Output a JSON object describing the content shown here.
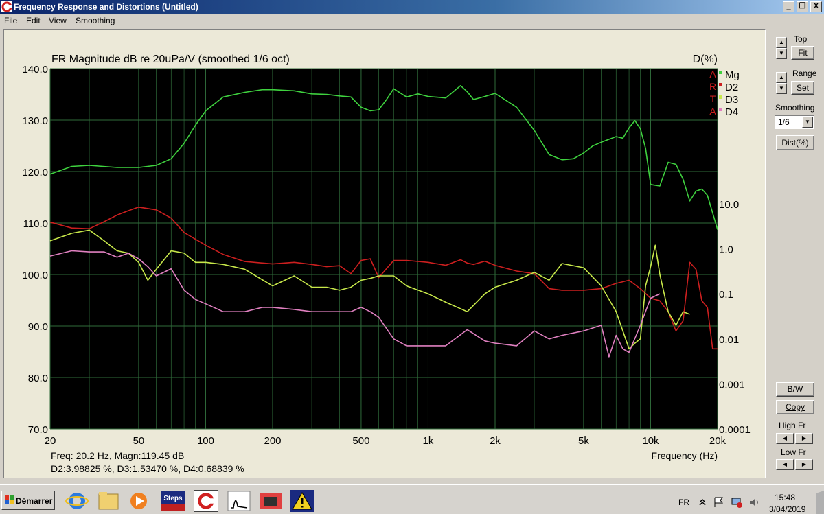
{
  "window": {
    "title": "Frequency Response and Distortions (Untitled)",
    "min_label": "_",
    "restore_label": "❐",
    "close_label": "X"
  },
  "menu": [
    "File",
    "Edit",
    "View",
    "Smoothing"
  ],
  "side_panel": {
    "top_label": "Top",
    "fit_label": "Fit",
    "range_label": "Range",
    "set_label": "Set",
    "smoothing_label": "Smoothing",
    "smoothing_value": "1/6",
    "dist_label": "Dist(%)",
    "bw_label": "B/W",
    "copy_label": "Copy",
    "high_fr_label": "High Fr",
    "low_fr_label": "Low Fr"
  },
  "readout": {
    "line1": "Freq: 20.2 Hz, Magn:119.45 dB",
    "line2": "D2:3.98825 %, D3:1.53470 %, D4:0.68839 %"
  },
  "taskbar": {
    "start_label": "Démarrer",
    "lang": "FR",
    "time": "15:48",
    "date": "3/04/2019",
    "app_icons": [
      "internet-explorer-icon",
      "folder-icon",
      "media-player-icon",
      "steps-icon",
      "arta-icon",
      "limp-icon",
      "video-icon",
      "warning-icon"
    ],
    "steps_text": "Steps"
  },
  "colors": {
    "plot_bg": "#000000",
    "grid": "#2f6b3a",
    "mg": "#3fd23f",
    "d2": "#cc1f1f",
    "d3": "#c8e84a",
    "d4": "#e080c0"
  },
  "chart_data": {
    "type": "line",
    "title": "FR Magnitude dB re 20uPa/V (smoothed 1/6 oct)",
    "xlabel": "Frequency (Hz)",
    "ylabel": "",
    "y2label": "D(%)",
    "xscale": "log",
    "xlim": [
      20,
      20000
    ],
    "ylim": [
      70,
      140
    ],
    "y2scale": "log",
    "y2lim": [
      0.0001,
      10000
    ],
    "grid": true,
    "x_ticks": [
      20,
      50,
      100,
      200,
      500,
      1000,
      2000,
      5000,
      10000,
      20000
    ],
    "x_tick_labels": [
      "20",
      "50",
      "100",
      "200",
      "500",
      "1k",
      "2k",
      "5k",
      "10k",
      "20k"
    ],
    "y_ticks": [
      70,
      80,
      90,
      100,
      110,
      120,
      130,
      140
    ],
    "y_tick_labels": [
      "70.0",
      "80.0",
      "90.0",
      "100.0",
      "110.0",
      "120.0",
      "130.0",
      "140.0"
    ],
    "y2_ticks": [
      0.0001,
      0.001,
      0.01,
      0.1,
      1,
      10
    ],
    "y2_tick_labels": [
      "0.0001",
      "0.001",
      "0.01",
      "0.1",
      "1.0",
      "10.0"
    ],
    "legend": {
      "placement": "top-right",
      "side_letters": [
        "A",
        "R",
        "T",
        "A"
      ],
      "entries": [
        "Mg",
        "D2",
        "D3",
        "D4"
      ]
    },
    "series": [
      {
        "name": "Mg",
        "axis": "left",
        "color": "#3fd23f",
        "x": [
          20,
          25,
          30,
          40,
          50,
          60,
          70,
          80,
          90,
          100,
          120,
          150,
          180,
          200,
          250,
          300,
          350,
          400,
          450,
          500,
          550,
          600,
          650,
          700,
          800,
          900,
          1000,
          1200,
          1400,
          1500,
          1600,
          1800,
          2000,
          2500,
          3000,
          3500,
          4000,
          4500,
          5000,
          5500,
          6000,
          7000,
          7500,
          8000,
          8500,
          9000,
          9500,
          10000,
          11000,
          12000,
          13000,
          14000,
          15000,
          16000,
          17000,
          18000,
          20000
        ],
        "y": [
          119.5,
          121,
          121.2,
          120.8,
          120.8,
          121.2,
          122.5,
          125.5,
          129,
          131.8,
          134.5,
          135.4,
          135.9,
          135.9,
          135.7,
          135.1,
          135,
          134.7,
          134.5,
          132.5,
          131.8,
          132,
          134,
          136.1,
          134.5,
          135.1,
          134.6,
          134.3,
          136.7,
          135.5,
          134.0,
          134.6,
          135.2,
          132.5,
          128,
          123.3,
          122.3,
          122.5,
          123.6,
          125.0,
          125.7,
          126.8,
          126.5,
          128.5,
          129.9,
          128.3,
          124.5,
          117.5,
          117.2,
          121.8,
          121.4,
          118.5,
          114.3,
          116.2,
          116.6,
          115.4,
          108.7
        ]
      },
      {
        "name": "D2",
        "axis": "right",
        "color": "#cc1f1f",
        "x": [
          20,
          25,
          30,
          35,
          40,
          45,
          50,
          60,
          70,
          80,
          100,
          120,
          150,
          200,
          250,
          300,
          350,
          400,
          450,
          500,
          550,
          600,
          700,
          800,
          1000,
          1200,
          1400,
          1500,
          1600,
          1800,
          2000,
          2500,
          3000,
          3500,
          4000,
          5000,
          6000,
          7000,
          8000,
          9000,
          10000,
          11000,
          12000,
          13000,
          14000,
          15000,
          16000,
          17000,
          18000,
          19000,
          20000
        ],
        "y": [
          3.9,
          2.9,
          2.8,
          4,
          5.6,
          7,
          8.4,
          7.3,
          4.8,
          2.3,
          1.2,
          0.75,
          0.52,
          0.46,
          0.5,
          0.45,
          0.4,
          0.42,
          0.28,
          0.55,
          0.6,
          0.23,
          0.55,
          0.55,
          0.5,
          0.43,
          0.57,
          0.48,
          0.45,
          0.53,
          0.43,
          0.32,
          0.28,
          0.13,
          0.12,
          0.12,
          0.13,
          0.17,
          0.2,
          0.13,
          0.08,
          0.07,
          0.04,
          0.015,
          0.025,
          0.5,
          0.35,
          0.07,
          0.05,
          0.006,
          0.006
        ]
      },
      {
        "name": "D3",
        "axis": "right",
        "color": "#c8e84a",
        "x": [
          20,
          25,
          30,
          35,
          40,
          45,
          50,
          55,
          60,
          70,
          80,
          90,
          100,
          120,
          150,
          200,
          250,
          300,
          350,
          400,
          450,
          500,
          550,
          600,
          700,
          800,
          1000,
          1200,
          1500,
          1800,
          2000,
          2500,
          3000,
          3500,
          4000,
          5000,
          6000,
          7000,
          8000,
          8500,
          9000,
          9500,
          10000,
          10500,
          11000,
          12000,
          13000,
          14000,
          15000
        ],
        "y": [
          1.5,
          2.2,
          2.6,
          1.5,
          0.9,
          0.8,
          0.5,
          0.2,
          0.35,
          0.9,
          0.8,
          0.5,
          0.5,
          0.45,
          0.35,
          0.15,
          0.25,
          0.14,
          0.14,
          0.12,
          0.14,
          0.2,
          0.22,
          0.25,
          0.25,
          0.15,
          0.1,
          0.065,
          0.04,
          0.1,
          0.14,
          0.2,
          0.3,
          0.2,
          0.47,
          0.38,
          0.15,
          0.04,
          0.006,
          0.008,
          0.01,
          0.15,
          0.4,
          1.2,
          0.27,
          0.04,
          0.02,
          0.04,
          0.035
        ]
      },
      {
        "name": "D4",
        "axis": "right",
        "color": "#e080c0",
        "x": [
          20,
          25,
          30,
          35,
          40,
          45,
          50,
          55,
          60,
          70,
          80,
          90,
          100,
          120,
          150,
          180,
          200,
          250,
          300,
          350,
          400,
          450,
          500,
          550,
          600,
          700,
          800,
          1000,
          1200,
          1500,
          1800,
          2000,
          2500,
          3000,
          3500,
          4000,
          5000,
          6000,
          6500,
          7000,
          7500,
          8000,
          9000,
          10000,
          11000
        ],
        "y": [
          0.69,
          0.9,
          0.85,
          0.85,
          0.65,
          0.8,
          0.6,
          0.4,
          0.25,
          0.36,
          0.12,
          0.075,
          0.06,
          0.04,
          0.04,
          0.05,
          0.05,
          0.045,
          0.04,
          0.04,
          0.04,
          0.04,
          0.05,
          0.04,
          0.03,
          0.01,
          0.007,
          0.007,
          0.007,
          0.016,
          0.009,
          0.008,
          0.007,
          0.015,
          0.01,
          0.012,
          0.015,
          0.02,
          0.004,
          0.012,
          0.006,
          0.005,
          0.02,
          0.08,
          0.1
        ]
      }
    ]
  }
}
